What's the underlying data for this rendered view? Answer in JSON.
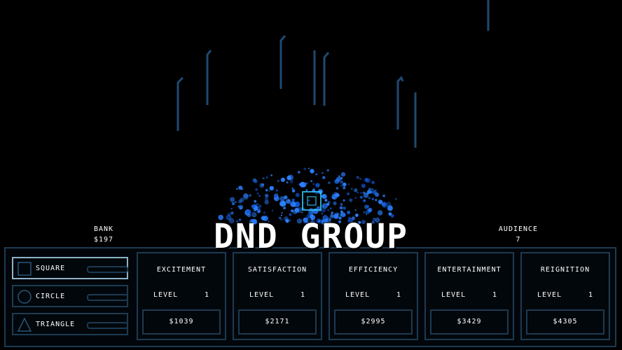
{
  "hud": {
    "bank_label": "BANK",
    "bank_value": "$197",
    "audience_label": "AUDIENCE",
    "audience_value": "7",
    "title": "DND GROUP"
  },
  "shapes": [
    {
      "label": "SQUARE",
      "icon": "square-icon",
      "selected": true
    },
    {
      "label": "CIRCLE",
      "icon": "circle-icon",
      "selected": false
    },
    {
      "label": "TRIANGLE",
      "icon": "triangle-icon",
      "selected": false
    }
  ],
  "upgrades": [
    {
      "name": "EXCITEMENT",
      "level_label": "LEVEL",
      "level": "1",
      "cost": "$1039"
    },
    {
      "name": "SATISFACTION",
      "level_label": "LEVEL",
      "level": "1",
      "cost": "$2171"
    },
    {
      "name": "EFFICIENCY",
      "level_label": "LEVEL",
      "level": "1",
      "cost": "$2995"
    },
    {
      "name": "ENTERTAINMENT",
      "level_label": "LEVEL",
      "level": "1",
      "cost": "$3429"
    },
    {
      "name": "REIGNITION",
      "level_label": "LEVEL",
      "level": "1",
      "cost": "$4305"
    }
  ],
  "colors": {
    "background": "#000000",
    "panel_border": "#1d3a52",
    "selected_border": "#8fb3c9",
    "particle": "#2a7fff",
    "streak": "#1e4a70"
  }
}
